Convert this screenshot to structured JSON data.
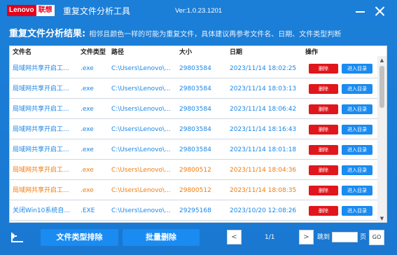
{
  "titlebar": {
    "logo_en": "Lenovo",
    "logo_cn": "联想",
    "title": "重复文件分析工具",
    "version": "Ver:1.0.23.1201"
  },
  "headline": {
    "strong": "重复文件分析结果:",
    "description": "相邻且颜色一样的可能为重复文件，具体建议再参考文件名、日期、文件类型判断"
  },
  "table": {
    "columns": [
      "文件名",
      "文件类型",
      "路径",
      "大小",
      "日期",
      "操作"
    ],
    "delete_label": "删除",
    "enter_label": "进入目录",
    "rows": [
      {
        "name": "局域网共享开启工...",
        "type": ".exe",
        "path": "C:\\Users\\Lenovo\\...",
        "size": "29803584",
        "date": "2023/11/14 18:02:25",
        "group": "blue"
      },
      {
        "name": "局域网共享开启工...",
        "type": ".exe",
        "path": "C:\\Users\\Lenovo\\...",
        "size": "29803584",
        "date": "2023/11/14 18:03:13",
        "group": "blue"
      },
      {
        "name": "局域网共享开启工...",
        "type": ".exe",
        "path": "C:\\Users\\Lenovo\\...",
        "size": "29803584",
        "date": "2023/11/14 18:06:42",
        "group": "blue"
      },
      {
        "name": "局域网共享开启工...",
        "type": ".exe",
        "path": "C:\\Users\\Lenovo\\...",
        "size": "29803584",
        "date": "2023/11/14 18:16:43",
        "group": "blue"
      },
      {
        "name": "局域网共享开启工...",
        "type": ".exe",
        "path": "C:\\Users\\Lenovo\\...",
        "size": "29803584",
        "date": "2023/11/14 18:01:18",
        "group": "blue"
      },
      {
        "name": "局域网共享开启工...",
        "type": ".exe",
        "path": "C:\\Users\\Lenovo\\...",
        "size": "29800512",
        "date": "2023/11/14 18:04:36",
        "group": "orange"
      },
      {
        "name": "局域网共享开启工...",
        "type": ".exe",
        "path": "C:\\Users\\Lenovo\\...",
        "size": "29800512",
        "date": "2023/11/14 18:08:35",
        "group": "orange"
      },
      {
        "name": "关闭Win10系统自...",
        "type": ".EXE",
        "path": "C:\\Users\\Lenovo\\...",
        "size": "29295168",
        "date": "2023/10/20 12:08:26",
        "group": "blue"
      }
    ]
  },
  "footer": {
    "type_exclude_label": "文件类型排除",
    "batch_delete_label": "批量删除",
    "prev_label": "<",
    "next_label": ">",
    "page_info": "1/1",
    "jump_label": "跳到",
    "jump_value": "",
    "page_unit": "页",
    "go_label": "GO"
  },
  "colors": {
    "background": "#1a78d1",
    "group_blue": "#1a86e6",
    "group_orange": "#ef7d12",
    "delete_button": "#e0161c",
    "enter_button": "#1a8bf0"
  },
  "icons": {
    "back": "back-arrow-icon",
    "minimize": "minimize-icon",
    "close": "close-icon"
  }
}
